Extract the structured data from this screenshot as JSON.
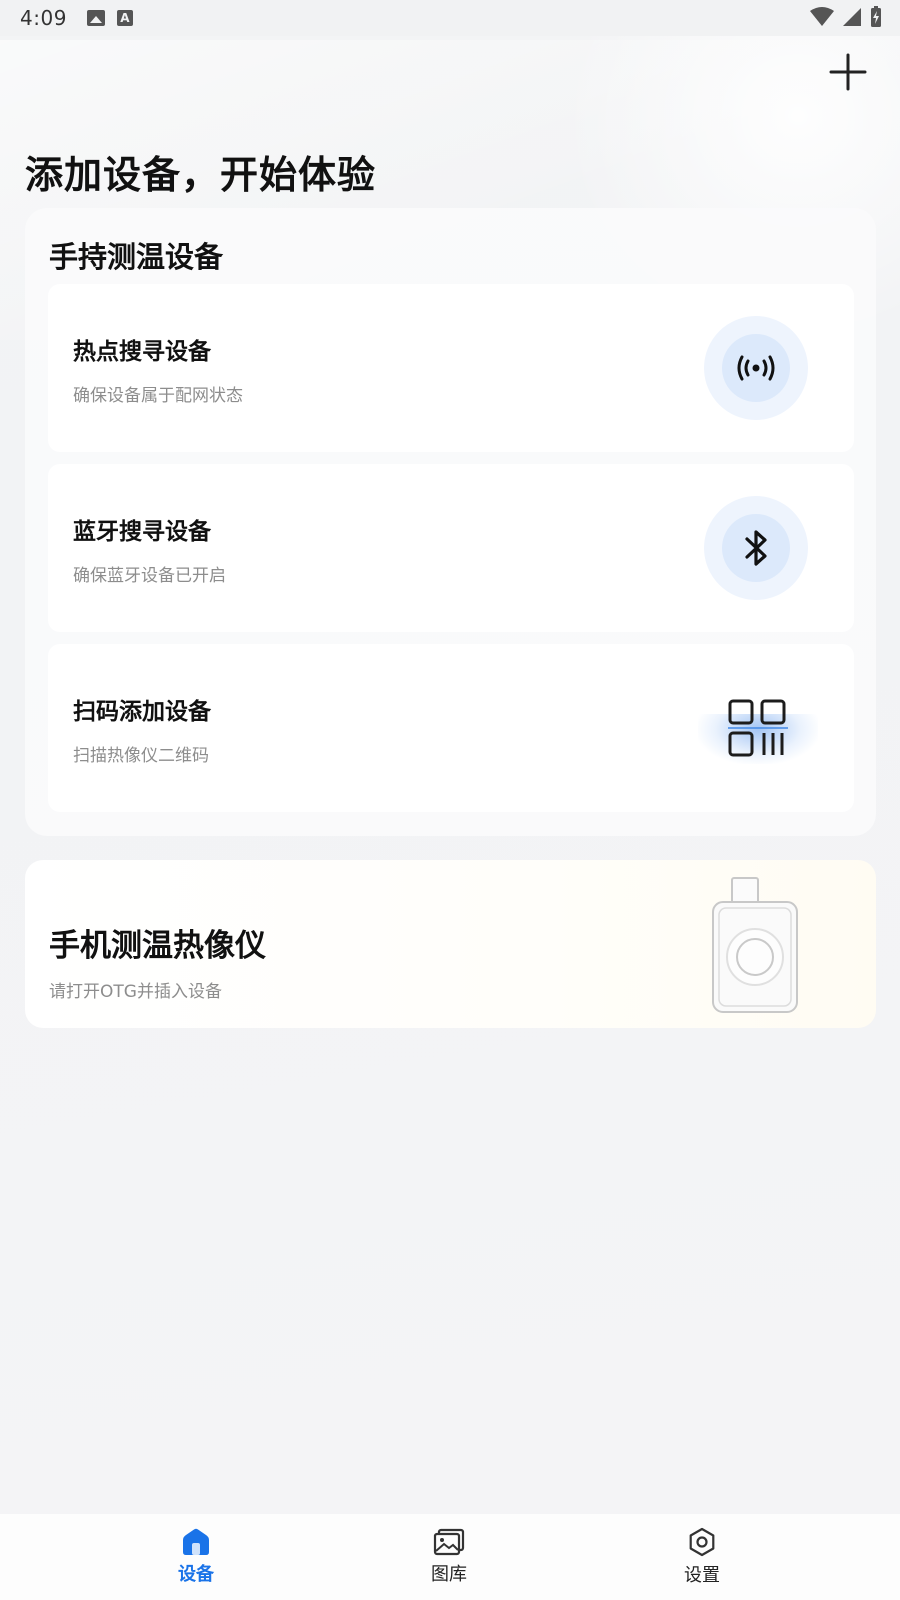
{
  "status_bar": {
    "time": "4:09"
  },
  "header": {
    "add_icon": "plus-icon",
    "title": "添加设备，开始体验"
  },
  "handheld_section": {
    "title": "手持测温设备",
    "options": [
      {
        "title": "热点搜寻设备",
        "subtitle": "确保设备属于配网状态",
        "icon": "hotspot-icon"
      },
      {
        "title": "蓝牙搜寻设备",
        "subtitle": "确保蓝牙设备已开启",
        "icon": "bluetooth-icon"
      },
      {
        "title": "扫码添加设备",
        "subtitle": "扫描热像仪二维码",
        "icon": "qr-scan-icon"
      }
    ]
  },
  "phone_section": {
    "title": "手机测温热像仪",
    "subtitle": "请打开OTG并插入设备"
  },
  "bottom_nav": {
    "items": [
      {
        "label": "设备",
        "icon": "home-icon",
        "active": true
      },
      {
        "label": "图库",
        "icon": "gallery-icon",
        "active": false
      },
      {
        "label": "设置",
        "icon": "settings-icon",
        "active": false
      }
    ]
  },
  "colors": {
    "accent": "#1a73e8",
    "icon_circle_outer": "#eef4fd",
    "icon_circle_inner": "#dce9fb"
  }
}
